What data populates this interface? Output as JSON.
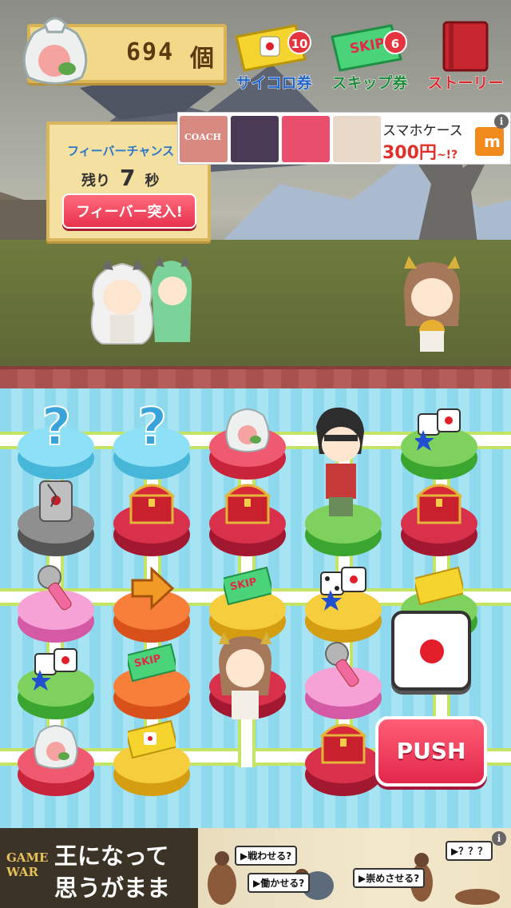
{
  "hud": {
    "counter_value": "694",
    "counter_unit": "個",
    "dice_ticket": {
      "label": "サイコロ券",
      "count": "10"
    },
    "skip_ticket": {
      "label": "スキップ券",
      "count": "6",
      "ticket_text": "SKIP"
    },
    "story": {
      "label": "ストーリー"
    }
  },
  "fever": {
    "title": "フィーバーチャンス",
    "remaining_prefix": "残り",
    "remaining_value": "7",
    "remaining_unit": "秒",
    "button_label": "フィーバー突入!"
  },
  "ad_top": {
    "line1": "スマホケース",
    "price": "300円",
    "price_suffix": "~!?",
    "brand_letter": "m",
    "thumb_text": "COACH",
    "info": "i"
  },
  "board": {
    "skip_text": "SKIP",
    "push_label": "PUSH"
  },
  "ad_bottom": {
    "logo_line1": "GAME",
    "logo_line2": "WAR",
    "headline1": "王になって",
    "headline2": "思うがまま",
    "bubble1": "▶戦わせる?",
    "bubble2": "▶働かせる?",
    "bubble3": "▶崇めさせる?",
    "bubble4": "▶？？？",
    "info": "i"
  },
  "colors": {
    "accent_pink": "#e8324d",
    "badge_red": "#e3343f",
    "path_green": "#c4e466"
  }
}
